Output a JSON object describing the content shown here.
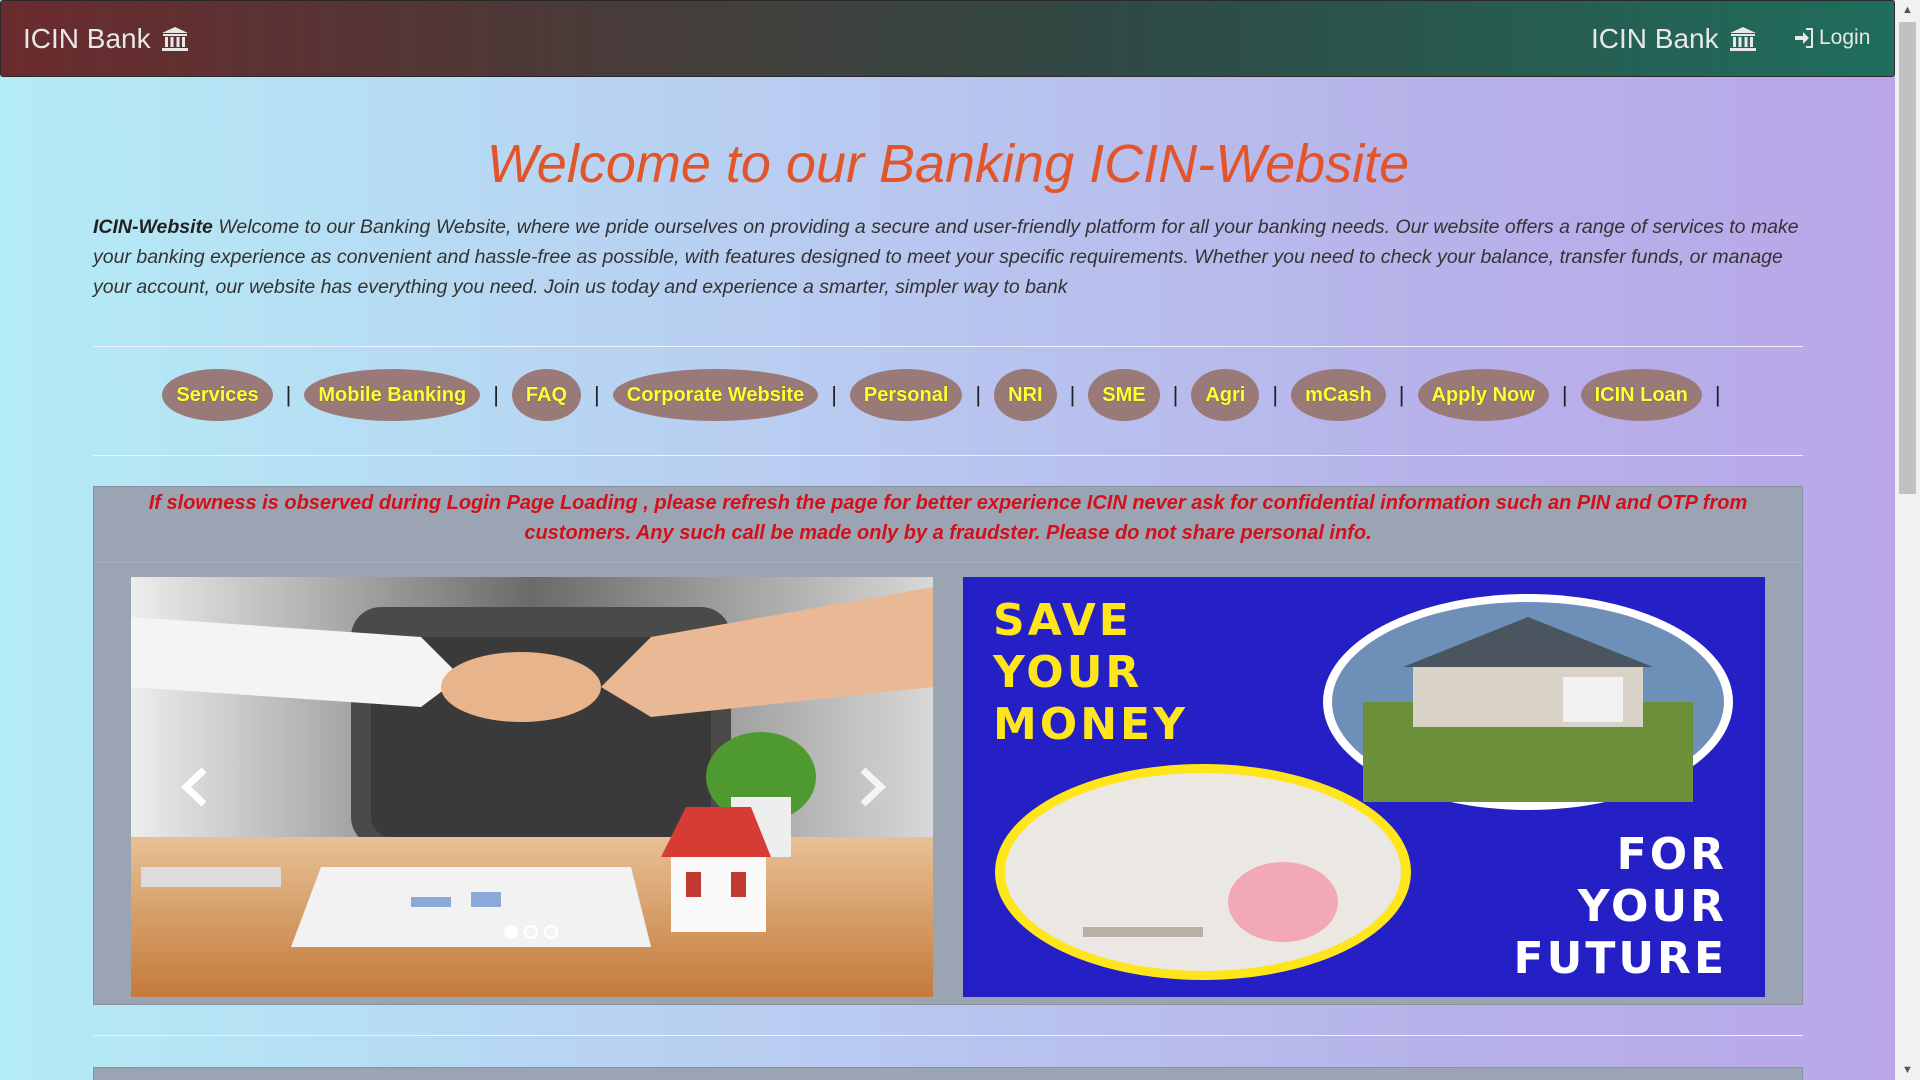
{
  "navbar": {
    "brand_left": "ICIN Bank",
    "brand_right": "ICIN Bank",
    "brand_icon": "bank-icon",
    "login_label": "Login",
    "login_icon": "sign-in-icon"
  },
  "hero": {
    "title": "Welcome to our Banking ICIN-Website",
    "intro_strong": "ICIN-Website",
    "intro_text": " Welcome to our Banking Website, where we pride ourselves on providing a secure and user-friendly platform for all your banking needs. Our website offers a range of services to make your banking experience as convenient and hassle-free as possible, with features designed to meet your specific requirements. Whether you need to check your balance, transfer funds, or manage your account, our website has everything you need. Join us today and experience a smarter, simpler way to bank"
  },
  "nav_links": [
    {
      "label": "Services"
    },
    {
      "label": "Mobile Banking"
    },
    {
      "label": "FAQ"
    },
    {
      "label": "Corporate Website"
    },
    {
      "label": "Personal"
    },
    {
      "label": "NRI"
    },
    {
      "label": "SME"
    },
    {
      "label": "Agri"
    },
    {
      "label": "mCash"
    },
    {
      "label": "Apply Now"
    },
    {
      "label": "ICIN Loan"
    }
  ],
  "nav_separator": "|",
  "notice": "If slowness is observed during Login Page Loading , please refresh the page for better experience ICIN never ask for confidential information such an PIN and OTP from customers. Any such call be made only by a fraudster. Please do not share personal info.",
  "carousel": {
    "prev_icon": "chevron-left-icon",
    "next_icon": "chevron-right-icon",
    "slides": 3,
    "active_slide": 1
  },
  "promo": {
    "headline_lines": [
      "SAVE",
      "YOUR",
      "MONEY"
    ],
    "tagline_lines": [
      "FOR",
      "YOUR",
      "FUTURE"
    ]
  },
  "colors": {
    "title": "#e2552a",
    "pill_text": "#ffff33",
    "pill_bg": "#9a7a78",
    "notice_text": "#d3101a",
    "promo_bg": "#2420c8",
    "promo_headline": "#ffe61a"
  }
}
